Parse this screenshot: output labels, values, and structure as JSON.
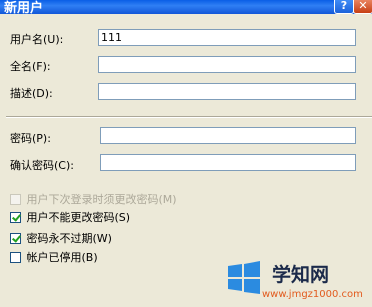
{
  "window": {
    "title": "新用户",
    "help_glyph": "?",
    "close_glyph": "✕"
  },
  "fields": {
    "username": {
      "label": "用户名(U):",
      "value": "111"
    },
    "fullname": {
      "label": "全名(F):",
      "value": ""
    },
    "description": {
      "label": "描述(D):",
      "value": ""
    },
    "password": {
      "label": "密码(P):",
      "value": ""
    },
    "confirm": {
      "label": "确认密码(C):",
      "value": ""
    }
  },
  "options": {
    "must_change": {
      "label": "用户下次登录时须更改密码(M)",
      "checked": false,
      "disabled": true
    },
    "cannot_change": {
      "label": "用户不能更改密码(S)",
      "checked": true
    },
    "never_expires": {
      "label": "密码永不过期(W)",
      "checked": true
    },
    "disabled_account": {
      "label": "帐户已停用(B)",
      "checked": false
    }
  },
  "watermark": {
    "text": "学知网",
    "url": "www.jmgz1000.com"
  }
}
